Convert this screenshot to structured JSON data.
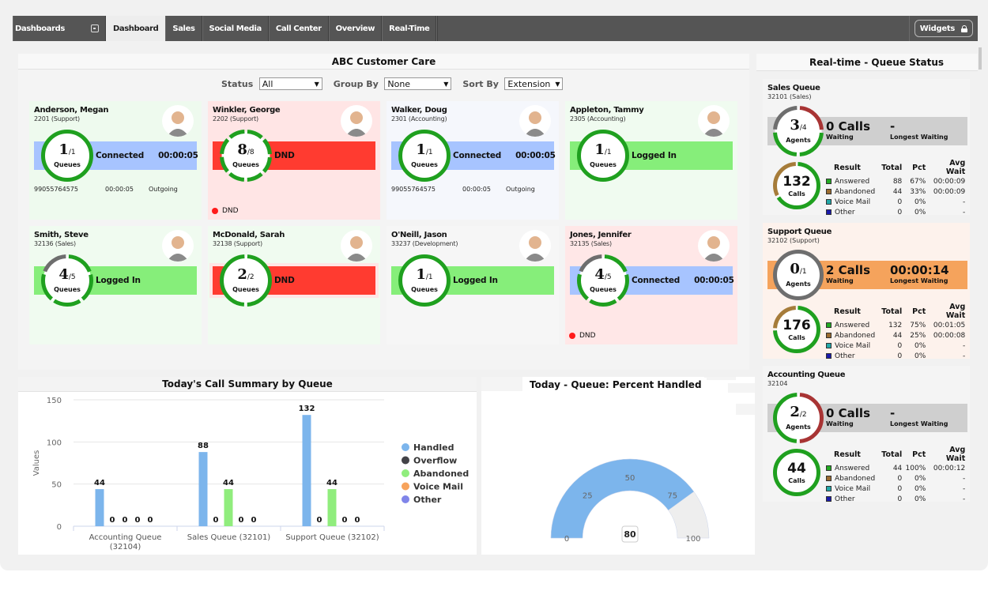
{
  "nav": {
    "dashboards_label": "Dashboards",
    "tabs": [
      {
        "label": "Dashboard",
        "active": true
      },
      {
        "label": "Sales",
        "active": false
      },
      {
        "label": "Social Media",
        "active": false
      },
      {
        "label": "Call Center",
        "active": false
      },
      {
        "label": "Overview",
        "active": false
      },
      {
        "label": "Real-Time",
        "active": false
      }
    ],
    "widgets_label": "Widgets"
  },
  "care": {
    "title": "ABC Customer Care",
    "filters": {
      "status_label": "Status",
      "status_value": "All",
      "group_label": "Group By",
      "group_value": "None",
      "sort_label": "Sort By",
      "sort_value": "Extension"
    },
    "agents": [
      {
        "name": "Anderson, Megan",
        "ext": "2201 (Support)",
        "queues": 1,
        "total": 1,
        "segments": [
          "g"
        ],
        "status": "Connected",
        "timer": "00:00:05",
        "status_color": "#a7c4ff",
        "card_bg": "#eefaee",
        "call": {
          "number": "99055764575",
          "time": "00:00:05",
          "dir": "Outgoing"
        },
        "dnd": false
      },
      {
        "name": "Winkler, George",
        "ext": "2202 (Support)",
        "queues": 8,
        "total": 8,
        "segments": [
          "g",
          "g",
          "g",
          "g",
          "g",
          "g",
          "g",
          "g"
        ],
        "status": "DND",
        "timer": "",
        "status_color": "#ff3b30",
        "card_bg": "#ffe5e5",
        "call": null,
        "dnd": true,
        "dnd_label": "DND"
      },
      {
        "name": "Walker, Doug",
        "ext": "2301 (Accounting)",
        "queues": 1,
        "total": 1,
        "segments": [
          "g"
        ],
        "status": "Connected",
        "timer": "00:00:05",
        "status_color": "#a7c4ff",
        "card_bg": "#f5f7fc",
        "call": {
          "number": "99055764575",
          "time": "00:00:05",
          "dir": "Outgoing"
        },
        "dnd": false
      },
      {
        "name": "Appleton, Tammy",
        "ext": "2305 (Accounting)",
        "queues": 1,
        "total": 1,
        "segments": [
          "g"
        ],
        "status": "Logged In",
        "timer": "",
        "status_color": "#86ee7a",
        "card_bg": "#f0fbf0",
        "call": null,
        "dnd": false
      },
      {
        "name": "Smith, Steve",
        "ext": "32136 (Sales)",
        "queues": 4,
        "total": 5,
        "segments": [
          "g",
          "g",
          "g",
          "g",
          "x"
        ],
        "status": "Logged In",
        "timer": "",
        "status_color": "#86ee7a",
        "card_bg": "#f0fbf0",
        "call": null,
        "dnd": false
      },
      {
        "name": "McDonald, Sarah",
        "ext": "32138 (Support)",
        "queues": 2,
        "total": 2,
        "segments": [
          "g",
          "g"
        ],
        "status": "DND",
        "timer": "",
        "status_color": "#ff3b30",
        "card_bg": "#f0fbf0",
        "call": null,
        "dnd": false
      },
      {
        "name": "O'Neill, Jason",
        "ext": "33237 (Development)",
        "queues": 1,
        "total": 1,
        "segments": [
          "g"
        ],
        "status": "Logged In",
        "timer": "",
        "status_color": "#86ee7a",
        "card_bg": "#f6f6f6",
        "call": null,
        "dnd": false
      },
      {
        "name": "Jones, Jennifer",
        "ext": "32135 (Sales)",
        "queues": 4,
        "total": 5,
        "segments": [
          "g",
          "g",
          "g",
          "g",
          "x"
        ],
        "status": "Connected",
        "timer": "00:00:05",
        "status_color": "#a7c4ff",
        "card_bg": "#ffe7e7",
        "call": null,
        "dnd": true,
        "dnd_label": "DND"
      }
    ],
    "ring_label": "Queues"
  },
  "realtime": {
    "title": "Real-time - Queue Status",
    "agents_label": "Agents",
    "calls_label": "Calls",
    "waiting_label": "Waiting",
    "longest_label": "Longest Waiting",
    "headers": [
      "Result",
      "Total",
      "Pct",
      "Avg Wait"
    ],
    "result_colors": [
      "#22aa22",
      "#9a6b2f",
      "#22a7a7",
      "#1a1aaa"
    ],
    "queues": [
      {
        "name": "Sales Queue",
        "ext": "32101 (Sales)",
        "agents": 3,
        "agents_total": 4,
        "agent_segments": [
          "r",
          "g",
          "g",
          "x"
        ],
        "calls_waiting": "0 Calls",
        "longest": "-",
        "bar_color": "#cfcfcf",
        "bg": "#f4f4f4",
        "calls_total": 132,
        "call_split": [
          88,
          44
        ],
        "rows": [
          {
            "result": "Answered",
            "total": "88",
            "pct": "67%",
            "avg": "00:00:09"
          },
          {
            "result": "Abandoned",
            "total": "44",
            "pct": "33%",
            "avg": "00:00:09"
          },
          {
            "result": "Voice Mail",
            "total": "0",
            "pct": "0%",
            "avg": "-"
          },
          {
            "result": "Other",
            "total": "0",
            "pct": "0%",
            "avg": "-"
          }
        ]
      },
      {
        "name": "Support Queue",
        "ext": "32102 (Support)",
        "agents": 0,
        "agents_total": 1,
        "agent_segments": [
          "x"
        ],
        "calls_waiting": "2 Calls",
        "longest": "00:00:14",
        "bar_color": "#f5a35c",
        "bg": "#fdf2ec",
        "calls_total": 176,
        "call_split": [
          132,
          44
        ],
        "rows": [
          {
            "result": "Answered",
            "total": "132",
            "pct": "75%",
            "avg": "00:01:05"
          },
          {
            "result": "Abandoned",
            "total": "44",
            "pct": "25%",
            "avg": "00:00:08"
          },
          {
            "result": "Voice Mail",
            "total": "0",
            "pct": "0%",
            "avg": "-"
          },
          {
            "result": "Other",
            "total": "0",
            "pct": "0%",
            "avg": "-"
          }
        ]
      },
      {
        "name": "Accounting Queue",
        "ext": "32104",
        "agents": 2,
        "agents_total": 2,
        "agent_segments": [
          "r",
          "g"
        ],
        "calls_waiting": "0 Calls",
        "longest": "-",
        "bar_color": "#cfcfcf",
        "bg": "#f4f4f4",
        "calls_total": 44,
        "call_split": [
          44,
          0
        ],
        "rows": [
          {
            "result": "Answered",
            "total": "44",
            "pct": "100%",
            "avg": "00:00:12"
          },
          {
            "result": "Abandoned",
            "total": "0",
            "pct": "0%",
            "avg": "-"
          },
          {
            "result": "Voice Mail",
            "total": "0",
            "pct": "0%",
            "avg": "-"
          },
          {
            "result": "Other",
            "total": "0",
            "pct": "0%",
            "avg": "-"
          }
        ]
      }
    ]
  },
  "chart_data": [
    {
      "type": "bar",
      "title": "Today's Call Summary by Queue",
      "xlabel": "",
      "ylabel": "Values",
      "ylim": [
        0,
        150
      ],
      "yticks": [
        0,
        50,
        100,
        150
      ],
      "grid": true,
      "legend_position": "right",
      "categories": [
        "Accounting Queue (32104)",
        "Sales Queue (32101)",
        "Support Queue (32102)"
      ],
      "series": [
        {
          "name": "Handled",
          "color": "#7cb5ec",
          "values": [
            44,
            88,
            132
          ]
        },
        {
          "name": "Overflow",
          "color": "#434348",
          "values": [
            0,
            0,
            0
          ]
        },
        {
          "name": "Abandoned",
          "color": "#90ed7d",
          "values": [
            0,
            44,
            44
          ]
        },
        {
          "name": "Voice Mail",
          "color": "#f7a35c",
          "values": [
            0,
            0,
            0
          ]
        },
        {
          "name": "Other",
          "color": "#8085e9",
          "values": [
            0,
            0,
            0
          ]
        }
      ]
    },
    {
      "type": "gauge",
      "title": "Today - Queue: Percent Handled",
      "value": 80,
      "range": [
        0,
        100
      ],
      "ticks": [
        0,
        25,
        50,
        75,
        100
      ],
      "fill_color": "#7cb5ec",
      "track_color": "#eeeeee"
    }
  ]
}
